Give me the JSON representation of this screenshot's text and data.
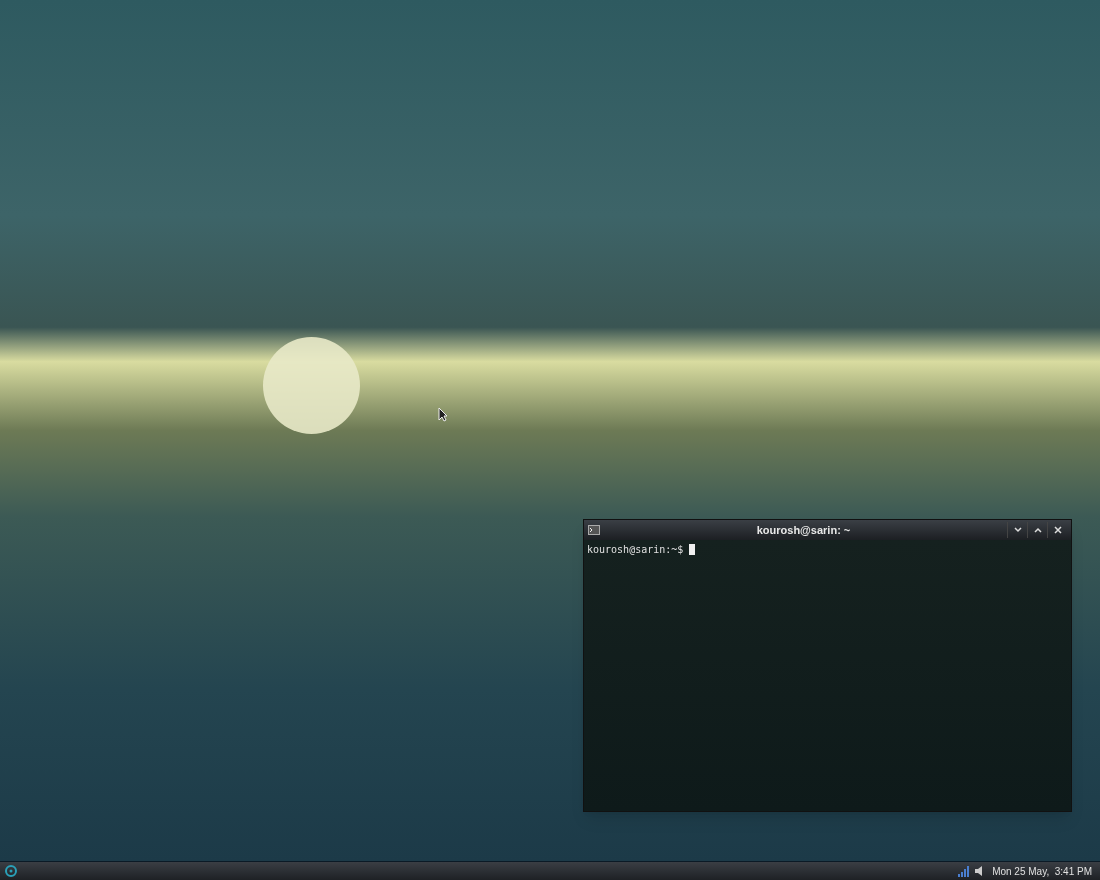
{
  "terminal": {
    "title": "kourosh@sarin: ~",
    "prompt": "kourosh@sarin:~$"
  },
  "taskbar": {
    "clock": "Mon 25 May,  3:41 PM"
  }
}
